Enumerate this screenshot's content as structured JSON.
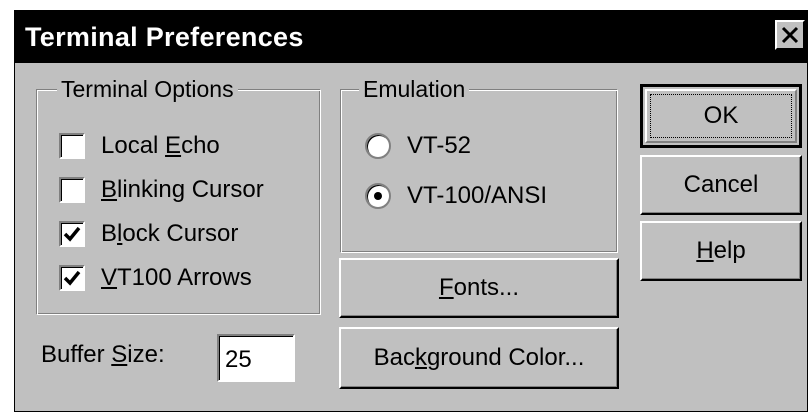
{
  "window": {
    "title": "Terminal Preferences",
    "close_icon": "close-x-icon"
  },
  "terminal_options": {
    "legend": "Terminal Options",
    "items": [
      {
        "pre": "Local ",
        "key": "E",
        "post": "cho",
        "checked": false
      },
      {
        "pre": "",
        "key": "B",
        "post": "linking Cursor",
        "checked": false
      },
      {
        "pre": "B",
        "key": "l",
        "post": "ock Cursor",
        "checked": true
      },
      {
        "pre": "",
        "key": "V",
        "post": "T100 Arrows",
        "checked": true
      }
    ]
  },
  "emulation": {
    "legend": "Emulation",
    "options": [
      {
        "label": "VT-52",
        "selected": false
      },
      {
        "label": "VT-100/ANSI",
        "selected": true
      }
    ]
  },
  "buttons": {
    "ok": "OK",
    "cancel": "Cancel",
    "help": {
      "key": "H",
      "post": "elp"
    },
    "fonts": {
      "key": "F",
      "post": "onts..."
    },
    "background": {
      "pre": "Bac",
      "key": "k",
      "post": "ground Color..."
    }
  },
  "buffer": {
    "label_pre": "Buffer ",
    "label_key": "S",
    "label_post": "ize:",
    "value": "25"
  }
}
